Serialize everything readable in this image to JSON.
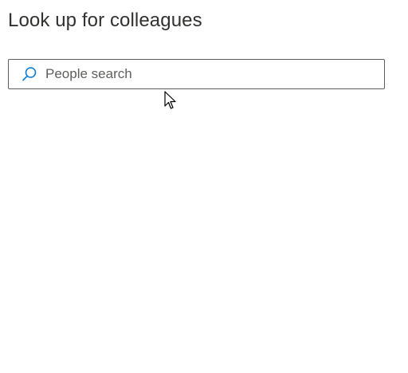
{
  "page": {
    "title": "Look up for colleagues"
  },
  "search": {
    "placeholder": "People search",
    "value": "",
    "icon": "search-icon"
  },
  "colors": {
    "accent": "#0078d4",
    "text": "#323130",
    "border": "#605e5c"
  }
}
